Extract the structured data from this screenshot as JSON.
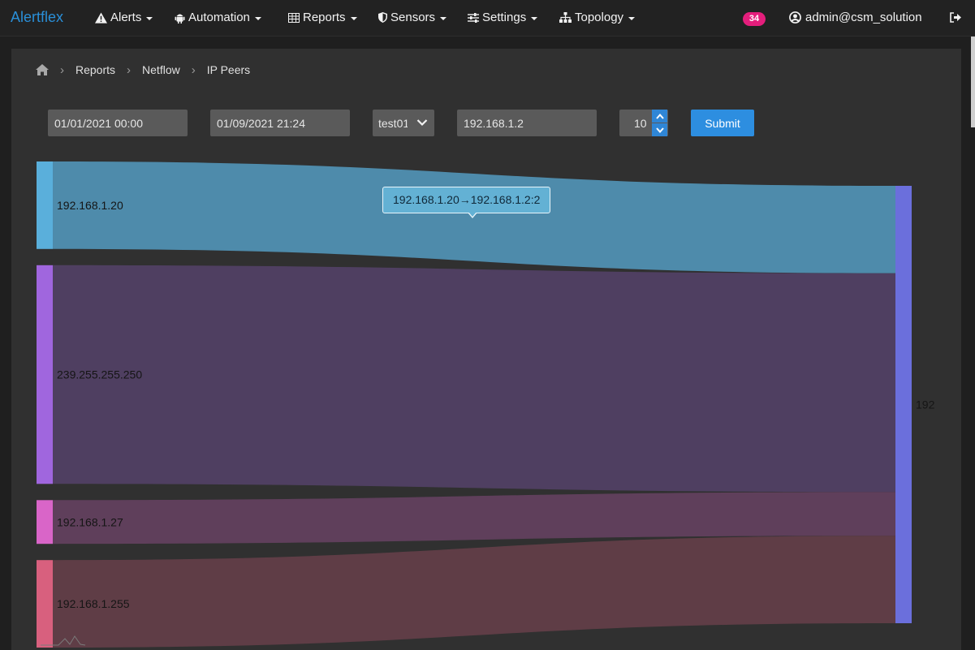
{
  "app": {
    "brand": "Alertflex"
  },
  "nav": {
    "items": [
      {
        "label": "Alerts",
        "icon": "warning-icon"
      },
      {
        "label": "Automation",
        "icon": "android-icon"
      },
      {
        "label": "Reports",
        "icon": "table-icon"
      },
      {
        "label": "Sensors",
        "icon": "shield-icon"
      },
      {
        "label": "Settings",
        "icon": "sliders-icon"
      },
      {
        "label": "Topology",
        "icon": "sitemap-icon"
      }
    ],
    "badge": "34",
    "user": "admin@csm_solution",
    "logout_icon": "sign-out-icon"
  },
  "breadcrumb": {
    "home_icon": "home-icon",
    "items": [
      "Reports",
      "Netflow",
      "IP Peers"
    ]
  },
  "form": {
    "start_date": "01/01/2021 00:00",
    "end_date": "01/09/2021 21:24",
    "sensor": "test01",
    "ip": "192.168.1.2",
    "limit": "10",
    "submit_label": "Submit"
  },
  "sankey": {
    "sources": [
      {
        "label": "192.168.1.20",
        "value": 2,
        "color": "#5aafdb"
      },
      {
        "label": "239.255.255.250",
        "value": 5,
        "color": "#a066de"
      },
      {
        "label": "192.168.1.27",
        "value": 1,
        "color": "#d965c8"
      },
      {
        "label": "192.168.1.255",
        "value": 2,
        "color": "#d8607e"
      }
    ],
    "target": {
      "label": "192",
      "color": "#6b6fdc"
    },
    "tooltip": "192.168.1.20→192.168.1.2:2"
  }
}
